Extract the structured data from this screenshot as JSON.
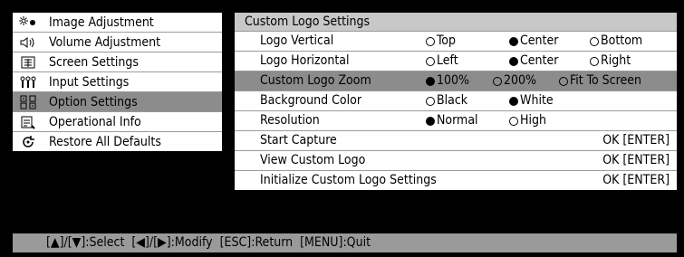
{
  "menu": {
    "items": [
      {
        "label": "Image Adjustment",
        "icon": "image-adjust-icon",
        "selected": false
      },
      {
        "label": "Volume Adjustment",
        "icon": "speaker-icon",
        "selected": false
      },
      {
        "label": "Screen Settings",
        "icon": "screen-icon",
        "selected": false
      },
      {
        "label": "Input Settings",
        "icon": "input-plug-icon",
        "selected": false
      },
      {
        "label": "Option Settings",
        "icon": "options-icon",
        "selected": true
      },
      {
        "label": "Operational Info",
        "icon": "info-icon",
        "selected": false
      },
      {
        "label": "Restore All Defaults",
        "icon": "restore-icon",
        "selected": false
      }
    ]
  },
  "panel": {
    "title": "Custom Logo Settings",
    "rows": {
      "logo_vertical": {
        "label": "Logo Vertical",
        "options": [
          "Top",
          "Center",
          "Bottom"
        ],
        "selected": 1
      },
      "logo_horizontal": {
        "label": "Logo Horizontal",
        "options": [
          "Left",
          "Center",
          "Right"
        ],
        "selected": 1
      },
      "custom_logo_zoom": {
        "label": "Custom Logo Zoom",
        "options": [
          "100%",
          "200%",
          "Fit To Screen"
        ],
        "selected": 0
      },
      "background_color": {
        "label": "Background Color",
        "options": [
          "Black",
          "White"
        ],
        "selected": 1
      },
      "resolution": {
        "label": "Resolution",
        "options": [
          "Normal",
          "High"
        ],
        "selected": 0
      },
      "start_capture": {
        "label": "Start Capture",
        "action": "OK [ENTER]"
      },
      "view_custom_logo": {
        "label": "View Custom Logo",
        "action": "OK [ENTER]"
      },
      "initialize": {
        "label": "Initialize Custom Logo Settings",
        "action": "OK [ENTER]"
      }
    }
  },
  "statusbar": {
    "text": "[▲]/[▼]:Select  [◀]/[▶]:Modify  [ESC]:Return  [MENU]:Quit"
  }
}
